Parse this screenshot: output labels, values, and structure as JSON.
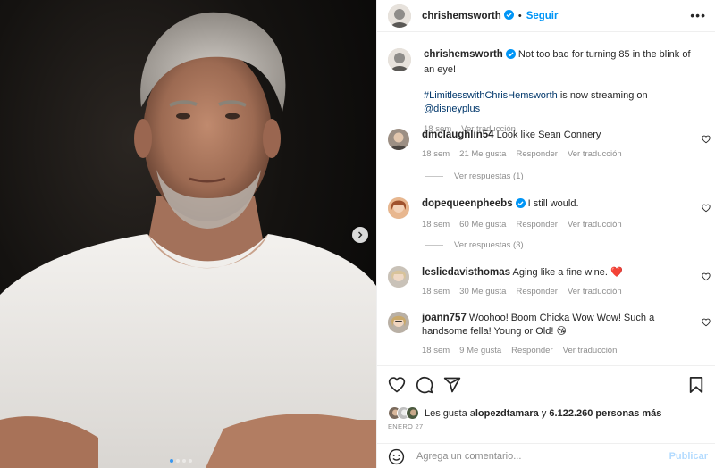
{
  "post": {
    "username": "chrishemsworth",
    "follow_label": "Seguir",
    "separator": "•",
    "more_label": "•••",
    "caption_line1": "Not too bad for turning 85 in the blink of an eye!",
    "hashtag": "#LimitlesswithChrisHemsworth",
    "caption_mid": " is now streaming on ",
    "mention": "@disneyplus",
    "caption_time": "18 sem",
    "see_translation": "Ver traducción",
    "carousel_dots": 4,
    "carousel_active_index": 0
  },
  "comments": [
    {
      "username": "dmclaughlin54",
      "verified": false,
      "text": "Look like Sean Connery",
      "time": "18 sem",
      "likes": "21 Me gusta",
      "reply": "Responder",
      "translate": "Ver traducción",
      "replies_label": "Ver respuestas (1)"
    },
    {
      "username": "dopequeenpheebs",
      "verified": true,
      "text": "I still would.",
      "time": "18 sem",
      "likes": "60 Me gusta",
      "reply": "Responder",
      "translate": "Ver traducción",
      "replies_label": "Ver respuestas (3)"
    },
    {
      "username": "lesliedavisthomas",
      "verified": false,
      "text": "Aging like a fine wine.",
      "emoji": "❤️",
      "time": "18 sem",
      "likes": "30 Me gusta",
      "reply": "Responder",
      "translate": "Ver traducción"
    },
    {
      "username": "joann757",
      "verified": false,
      "text": "Woohoo! Boom Chicka Wow Wow! Such a handsome fella! Young or Old!",
      "emoji": "😘",
      "time": "18 sem",
      "likes": "9 Me gusta",
      "reply": "Responder",
      "translate": "Ver traducción"
    }
  ],
  "likes_bar": {
    "prefix": "Les gusta a ",
    "user": "lopezdtamara",
    "connector": " y ",
    "count": "6.122.260 personas más",
    "date": "ENERO 27"
  },
  "composer": {
    "placeholder": "Agrega un comentario...",
    "publish_label": "Publicar"
  },
  "icons": [
    "heart-icon",
    "comment-icon",
    "share-icon",
    "bookmark-icon",
    "emoji-icon",
    "more-icon",
    "verified-icon",
    "chevron-right-icon"
  ],
  "colors": {
    "accent": "#0095f6",
    "link": "#00376b",
    "meta": "#8e8e8e",
    "publish_disabled": "#b3dbff",
    "heart": "#ed4956"
  }
}
